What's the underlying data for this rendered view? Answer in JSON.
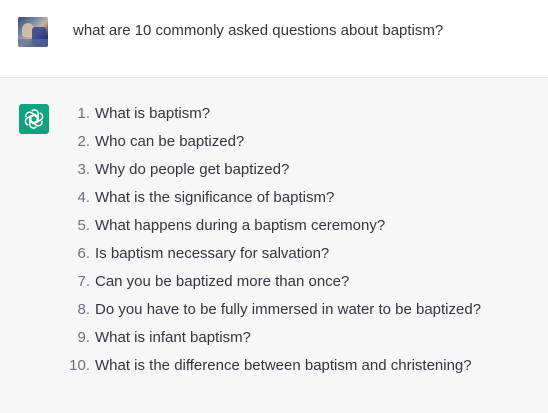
{
  "user_message": {
    "avatar": "user-photo-avatar",
    "text": "what are 10 commonly asked questions about baptism?"
  },
  "assistant_message": {
    "icon": "openai-logo-icon",
    "brand_color": "#10a37f",
    "items": [
      {
        "num": "1.",
        "text": "What is baptism?"
      },
      {
        "num": "2.",
        "text": "Who can be baptized?"
      },
      {
        "num": "3.",
        "text": "Why do people get baptized?"
      },
      {
        "num": "4.",
        "text": "What is the significance of baptism?"
      },
      {
        "num": "5.",
        "text": "What happens during a baptism ceremony?"
      },
      {
        "num": "6.",
        "text": "Is baptism necessary for salvation?"
      },
      {
        "num": "7.",
        "text": "Can you be baptized more than once?"
      },
      {
        "num": "8.",
        "text": "Do you have to be fully immersed in water to be baptized?"
      },
      {
        "num": "9.",
        "text": "What is infant baptism?"
      },
      {
        "num": "10.",
        "text": "What is the difference between baptism and christening?"
      }
    ]
  }
}
